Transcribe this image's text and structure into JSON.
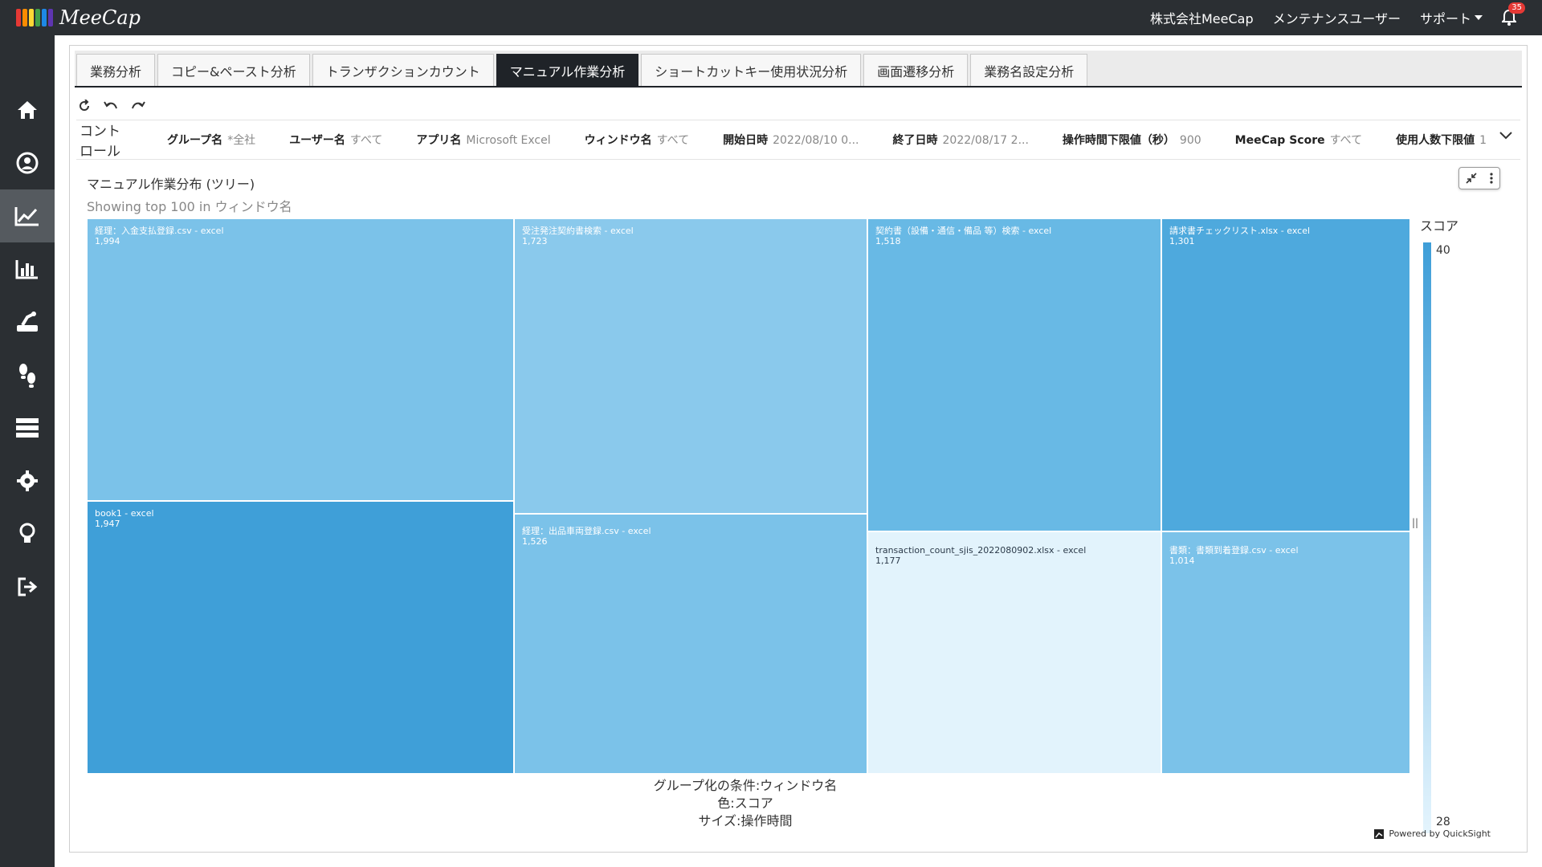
{
  "app": {
    "logo_text": "MeeCap",
    "logo_colors": [
      "#e53935",
      "#fb8c00",
      "#fdd835",
      "#43a047",
      "#1e88e5",
      "#5e35b1"
    ],
    "company": "株式会社MeeCap",
    "user": "メンテナンスユーザー",
    "support": "サポート",
    "notifications": "35"
  },
  "sidebar": {
    "items": [
      {
        "icon": "home-icon"
      },
      {
        "icon": "user-icon"
      },
      {
        "icon": "trend-chart-icon",
        "active": true
      },
      {
        "icon": "bar-chart-icon"
      },
      {
        "icon": "robot-icon"
      },
      {
        "icon": "footsteps-icon"
      },
      {
        "icon": "server-icon"
      },
      {
        "icon": "gear-icon"
      },
      {
        "icon": "lightbulb-icon"
      },
      {
        "icon": "logout-icon"
      }
    ]
  },
  "tabs": [
    {
      "label": "業務分析"
    },
    {
      "label": "コピー&ペースト分析"
    },
    {
      "label": "トランザクションカウント"
    },
    {
      "label": "マニュアル作業分析",
      "active": true
    },
    {
      "label": "ショートカットキー使用状況分析"
    },
    {
      "label": "画面遷移分析"
    },
    {
      "label": "業務名設定分析"
    }
  ],
  "controls": {
    "title": "コントロール",
    "items": [
      {
        "label": "グループ名",
        "value": "*全社"
      },
      {
        "label": "ユーザー名",
        "value": "すべて"
      },
      {
        "label": "アプリ名",
        "value": "Microsoft Excel"
      },
      {
        "label": "ウィンドウ名",
        "value": "すべて"
      },
      {
        "label": "開始日時",
        "value": "2022/08/10 0..."
      },
      {
        "label": "終了日時",
        "value": "2022/08/17 2..."
      },
      {
        "label": "操作時間下限値（秒）",
        "value": "900"
      },
      {
        "label": "MeeCap Score",
        "value": "すべて"
      },
      {
        "label": "使用人数下限値",
        "value": "1"
      }
    ]
  },
  "visual": {
    "title": "マニュアル作業分布 (ツリー)",
    "subtitle": "Showing top 100 in ウィンドウ名",
    "caption": [
      "グループ化の条件:ウィンドウ名",
      "色:スコア",
      "サイズ:操作時間"
    ],
    "powered_by": "Powered by QuickSight"
  },
  "chart_data": {
    "type": "treemap",
    "group_by": "ウィンドウ名",
    "size_measure": "操作時間",
    "color_measure": "スコア",
    "legend": {
      "title": "スコア",
      "max": "40",
      "min": "28",
      "color_high": "#3e9ed8",
      "color_low": "#e4f4fd"
    },
    "items": [
      {
        "label": "経理：入金支払登録.csv - excel",
        "value": "1,994",
        "color": "#7bc2e9"
      },
      {
        "label": "book1 - excel",
        "value": "1,947",
        "color": "#3f9fd8"
      },
      {
        "label": "受注発注契約書検索 - excel",
        "value": "1,723",
        "color": "#8ac9ec"
      },
      {
        "label": "経理：出品車両登録.csv - excel",
        "value": "1,526",
        "color": "#7bc2e9"
      },
      {
        "label": "契約書（設備・通信・備品 等）検索 - excel",
        "value": "1,518",
        "color": "#68b9e5"
      },
      {
        "label": "請求書チェックリスト.xlsx - excel",
        "value": "1,301",
        "color": "#4ea9dd"
      },
      {
        "label": "transaction_count_sjis_2022080902.xlsx - excel",
        "value": "1,177",
        "color": "#e2f3fc"
      },
      {
        "label": "書類：書類到着登録.csv - excel",
        "value": "1,014",
        "color": "#7bc2e9"
      }
    ]
  }
}
